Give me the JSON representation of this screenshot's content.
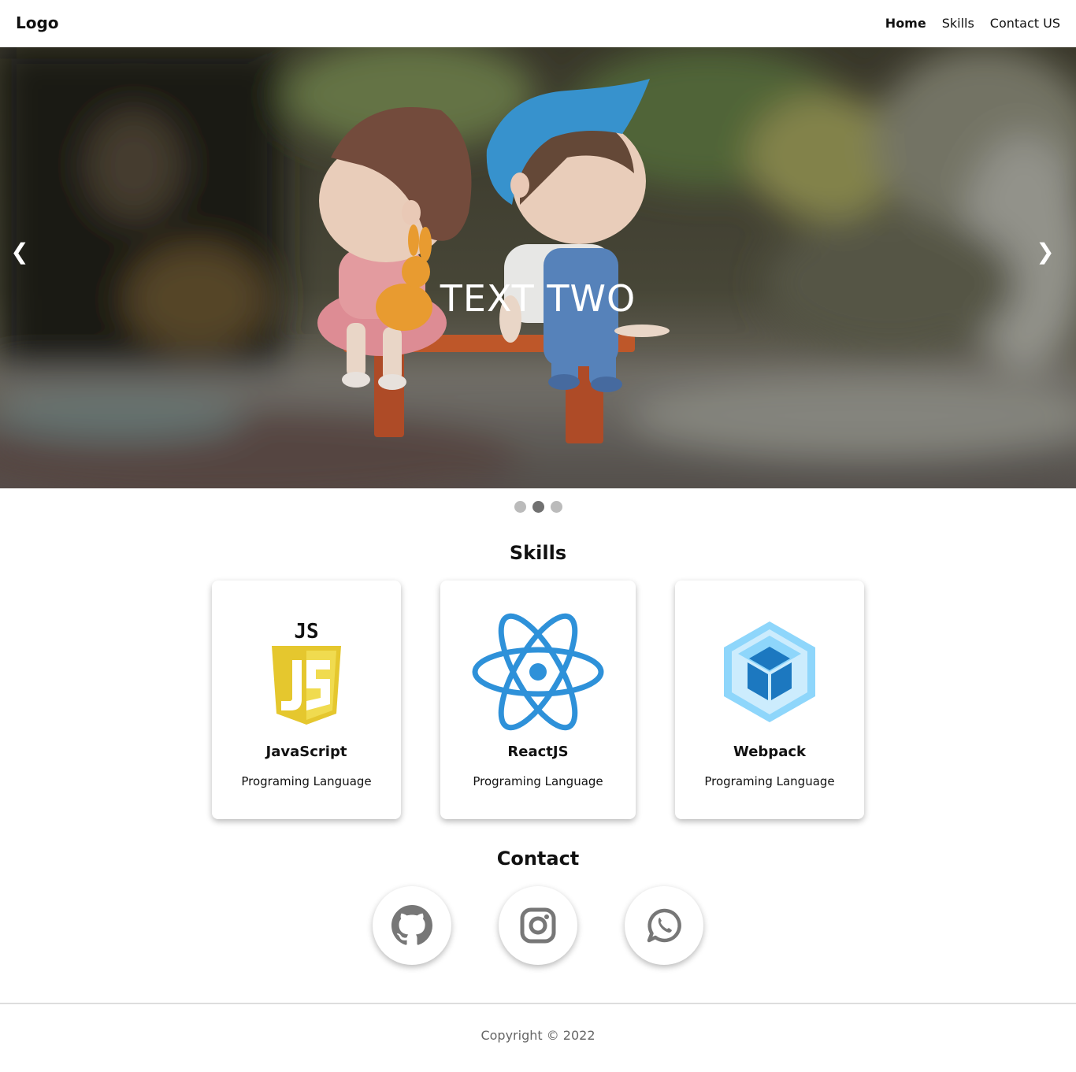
{
  "navbar": {
    "logo": "Logo",
    "links": [
      "Home",
      "Skills",
      "Contact US"
    ],
    "active_link": "Home"
  },
  "hero": {
    "caption": "TEXT TWO",
    "prev_arrow": "❮",
    "next_arrow": "❯",
    "slide_count": 3,
    "active_slide": 2
  },
  "skills": {
    "title": "Skills",
    "cards": [
      {
        "icon": "javascript-logo-icon",
        "name": "JavaScript",
        "subtitle": "Programing Language",
        "icon_label": "JS"
      },
      {
        "icon": "react-logo-icon",
        "name": "ReactJS",
        "subtitle": "Programing Language"
      },
      {
        "icon": "webpack-logo-icon",
        "name": "Webpack",
        "subtitle": "Programing Language"
      }
    ]
  },
  "contact": {
    "title": "Contact",
    "links": [
      {
        "icon": "github-icon"
      },
      {
        "icon": "instagram-icon"
      },
      {
        "icon": "whatsapp-icon"
      }
    ]
  },
  "footer": {
    "copyright": "Copyright © 2022"
  },
  "colors": {
    "js_yellow": "#F0DB4F",
    "react_blue": "#2E91D9",
    "webpack_light": "#8ED6FB",
    "webpack_dark": "#1C78C0",
    "icon_gray": "#777777",
    "dot_active": "#717171",
    "dot_inactive": "#bbbbbb"
  }
}
